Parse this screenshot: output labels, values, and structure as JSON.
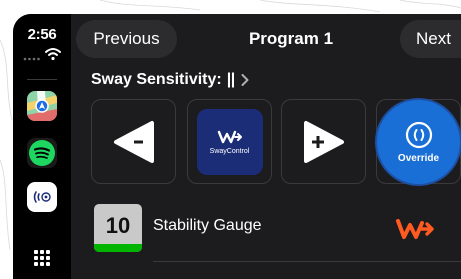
{
  "status": {
    "time": "2:56"
  },
  "sidebar": {
    "apps": [
      {
        "name": "maps-app-icon"
      },
      {
        "name": "spotify-app-icon"
      },
      {
        "name": "sway-app-icon"
      }
    ]
  },
  "header": {
    "previous_label": "Previous",
    "title": "Program 1",
    "next_label": "Next"
  },
  "sensitivity": {
    "label": "Sway Sensitivity:",
    "value": "||"
  },
  "controls": {
    "sway_logo_text": "SwayControl",
    "override_label": "Override"
  },
  "gauge": {
    "value": "10",
    "label": "Stability Gauge",
    "bar_color": "#00b400"
  },
  "colors": {
    "accent_blue": "#1a6fd6",
    "brand_orange": "#ff5a1f",
    "sway_brand_navy": "#1c2d78"
  },
  "icons": [
    "minus-icon",
    "plus-icon",
    "override-icon",
    "chevron-right-icon",
    "wifi-icon",
    "grid-icon"
  ]
}
